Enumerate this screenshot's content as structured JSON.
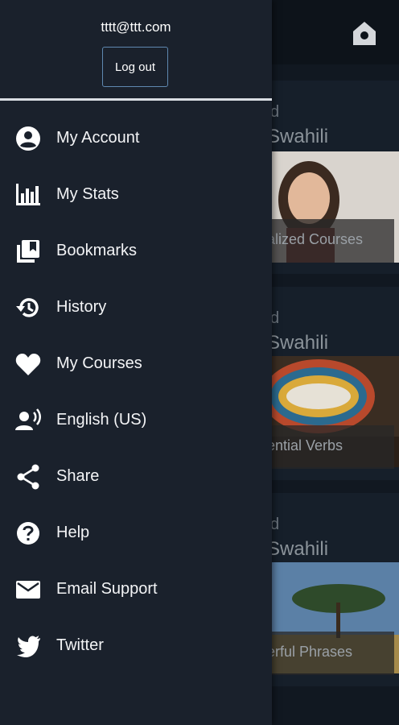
{
  "drawer": {
    "email": "tttt@ttt.com",
    "logout_label": "Log out",
    "items": [
      {
        "label": "My Account",
        "icon": "account-icon"
      },
      {
        "label": "My Stats",
        "icon": "stats-icon"
      },
      {
        "label": "Bookmarks",
        "icon": "bookmarks-icon"
      },
      {
        "label": "History",
        "icon": "history-icon"
      },
      {
        "label": "My Courses",
        "icon": "heart-icon"
      },
      {
        "label": "English (US)",
        "icon": "language-voice-icon"
      },
      {
        "label": "Share",
        "icon": "share-icon"
      },
      {
        "label": "Help",
        "icon": "help-icon"
      },
      {
        "label": "Email Support",
        "icon": "email-icon"
      },
      {
        "label": "Twitter",
        "icon": "twitter-icon"
      }
    ]
  },
  "background": {
    "courses": [
      {
        "level": "d",
        "language": "Swahili",
        "caption": "alized Courses"
      },
      {
        "level": "d",
        "language": "Swahili",
        "caption": "ential Verbs"
      },
      {
        "level": "d",
        "language": "Swahili",
        "caption": "erful Phrases"
      }
    ]
  },
  "colors": {
    "drawer_bg": "#1a212c",
    "logout_border": "#5f88b0",
    "divider": "#d9dde2"
  }
}
